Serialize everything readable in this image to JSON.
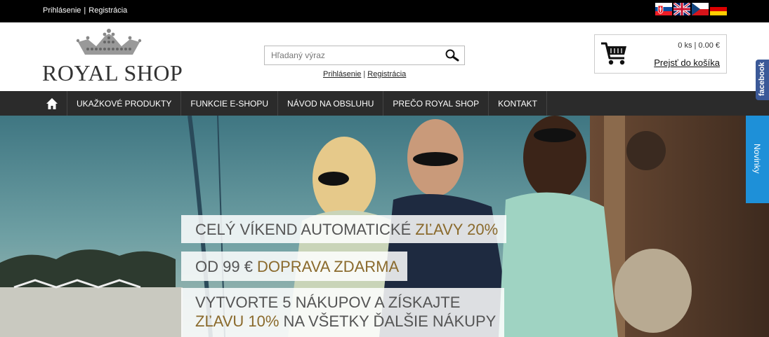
{
  "topbar": {
    "login": "Prihlásenie",
    "separator": "|",
    "register": "Registrácia",
    "flags": [
      "sk-flag-icon",
      "uk-flag-icon",
      "cz-flag-icon",
      "de-flag-icon"
    ]
  },
  "header": {
    "logo_text": "ROYAL SHOP",
    "search_placeholder": "Hľadaný výraz",
    "login": "Prihlásenie",
    "separator": "|",
    "register": "Registrácia"
  },
  "cart": {
    "count": "0 ks | 0.00 €",
    "link": "Prejsť do košíka"
  },
  "nav": {
    "items": [
      "UKAŽKOVÉ PRODUKTY",
      "FUNKCIE E-SHOPU",
      "NÁVOD NA OBSLUHU",
      "PREČO ROYAL SHOP",
      "KONTAKT"
    ]
  },
  "hero": {
    "banner1_a": "CELÝ VÍKEND AUTOMATICKÉ ",
    "banner1_b": "ZĽAVY 20%",
    "banner2_a": "OD 99 € ",
    "banner2_b": "DOPRAVA ZDARMA",
    "banner3_line1": "VYTVORTE 5 NÁKUPOV A ZÍSKAJTE",
    "banner3_b": "ZĽAVU 10%",
    "banner3_c": " NA VŠETKY ĎALŠIE NÁKUPY"
  },
  "side": {
    "facebook": "facebook",
    "novinky": "Novinky"
  },
  "colors": {
    "accent_text": "#8a6a2c",
    "nav_bg": "#2b2b2b",
    "facebook": "#3b5998",
    "novinky": "#1e90d8"
  }
}
